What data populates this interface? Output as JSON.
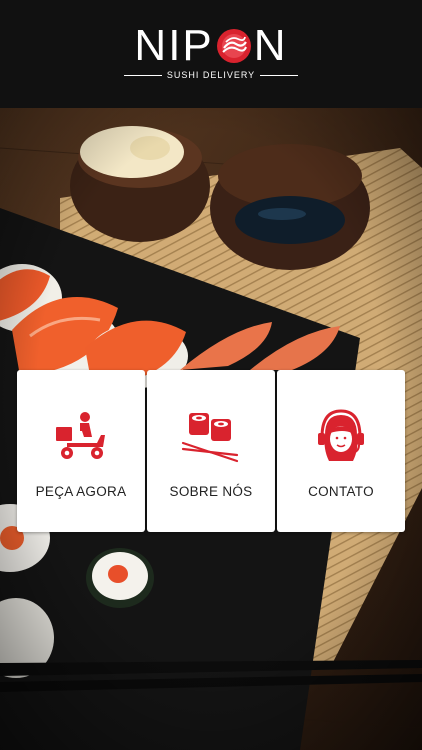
{
  "brand": {
    "name_left": "NIP",
    "name_right": "N",
    "tagline": "SUSHI DELIVERY",
    "accent_color": "#d9232e"
  },
  "menu": [
    {
      "label": "PEÇA AGORA",
      "icon": "delivery-scooter-icon"
    },
    {
      "label": "SOBRE NÓS",
      "icon": "sushi-chopsticks-icon"
    },
    {
      "label": "CONTATO",
      "icon": "headset-support-icon"
    }
  ]
}
